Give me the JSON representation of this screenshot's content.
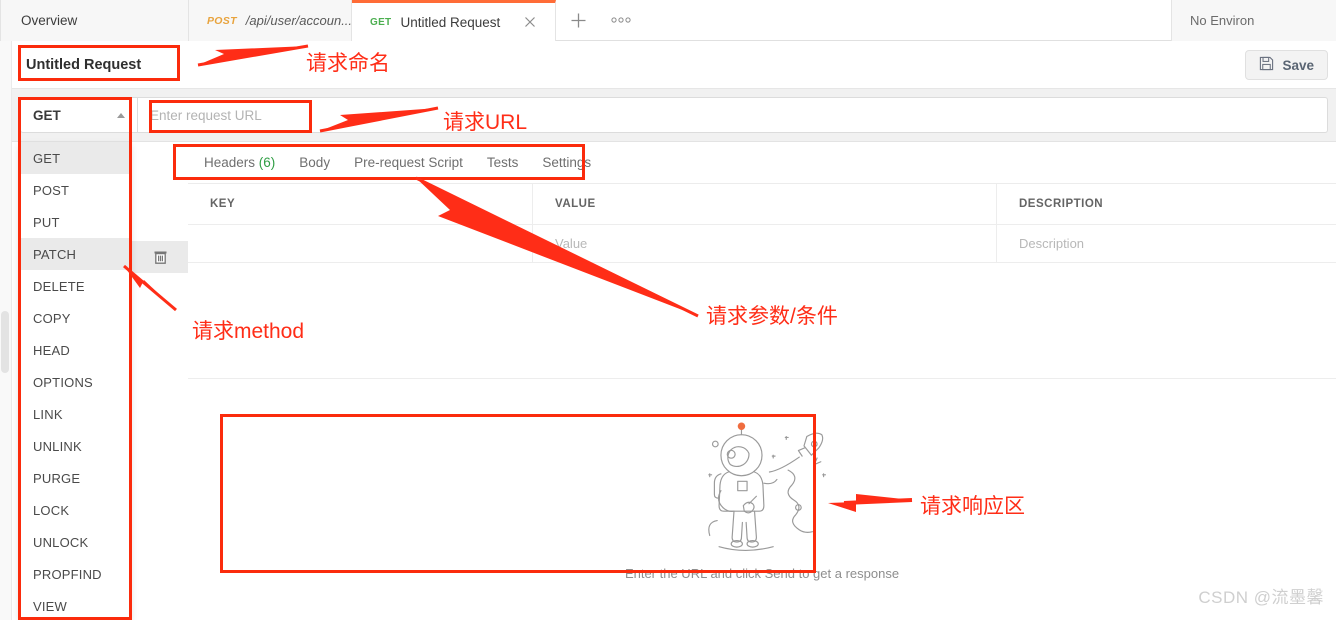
{
  "tabbar": {
    "tabs": [
      {
        "label": "Overview",
        "method": "",
        "closable": false
      },
      {
        "label": "/api/user/accoun...",
        "method": "POST",
        "closable": false
      },
      {
        "label": "Untitled Request",
        "method": "GET",
        "closable": true
      }
    ],
    "new_tab_icon": "plus-icon",
    "more_icon": "ellipsis-icon",
    "environment_selector": "No Environ"
  },
  "request": {
    "name": "Untitled Request",
    "save_label": "Save",
    "save_icon": "floppy-disk-icon",
    "method": "GET",
    "url_placeholder": "Enter request URL"
  },
  "method_dropdown": {
    "items": [
      "GET",
      "POST",
      "PUT",
      "PATCH",
      "DELETE",
      "COPY",
      "HEAD",
      "OPTIONS",
      "LINK",
      "UNLINK",
      "PURGE",
      "LOCK",
      "UNLOCK",
      "PROPFIND",
      "VIEW"
    ],
    "selected": "GET",
    "hovered": "PATCH",
    "delete_icon": "trash-icon"
  },
  "request_tabs": [
    {
      "label": "Headers",
      "count": "(6)"
    },
    {
      "label": "Body",
      "count": ""
    },
    {
      "label": "Pre-request Script",
      "count": ""
    },
    {
      "label": "Tests",
      "count": ""
    },
    {
      "label": "Settings",
      "count": ""
    }
  ],
  "headers_table": {
    "columns": [
      "KEY",
      "VALUE",
      "DESCRIPTION"
    ],
    "rows": [
      {
        "key": "",
        "value": "Value",
        "description": "Description"
      }
    ]
  },
  "response": {
    "illustration": "astronaut-rocket-illustration",
    "hint": "Enter the URL and click Send to get a response"
  },
  "annotations": [
    {
      "id": "name-anno",
      "text": "请求命名"
    },
    {
      "id": "url-anno",
      "text": "请求URL"
    },
    {
      "id": "method-anno",
      "text": "请求method"
    },
    {
      "id": "params-anno",
      "text": "请求参数/条件"
    },
    {
      "id": "resp-anno",
      "text": "请求响应区"
    }
  ],
  "watermark": "CSDN @流墨馨",
  "colors": {
    "accent_orange": "#ff6c37",
    "get_green": "#4caf50",
    "post_orange": "#e8a33d",
    "annotation_red": "#ff2d17"
  }
}
